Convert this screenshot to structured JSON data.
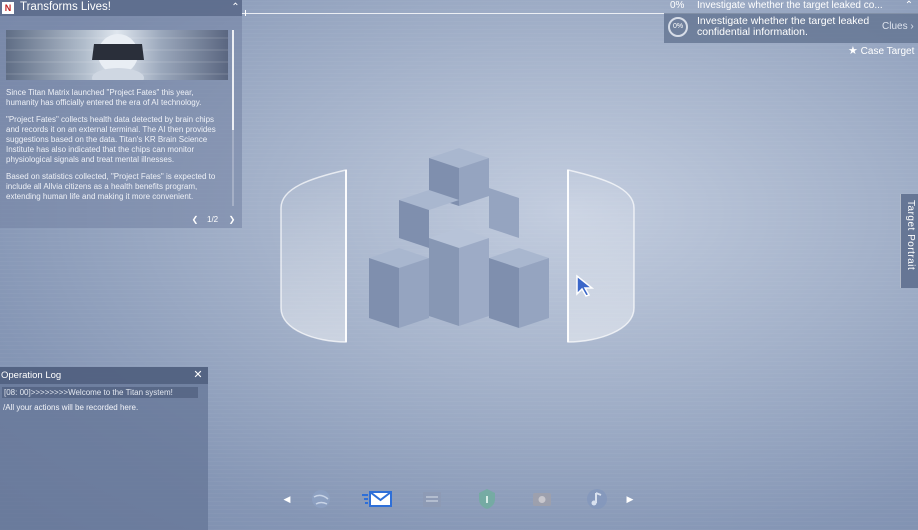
{
  "news": {
    "logo": "N",
    "title": "Transforms Lives!",
    "paragraphs": [
      "Since Titan Matrix launched \"Project Fates\" this year, humanity has officially entered the era of AI technology.",
      "\"Project Fates\" collects health data detected by brain chips and records it on an external terminal. The AI then provides suggestions based on the data. Titan's KR Brain Science Institute has also indicated that the chips can monitor physiological signals and treat mental illnesses.",
      "Based on statistics collected, \"Project Fates\" is expected to include all Allvia citizens as a health benefits program, extending human life and making it more convenient."
    ],
    "page": "1/2"
  },
  "mission": {
    "top_percent": "0%",
    "top_text": "Investigate whether the target leaked co...",
    "card_percent": "0%",
    "card_text": "Investigate whether the target leaked confidential information.",
    "clues_label": "Clues"
  },
  "case_target": "Case Target",
  "side_tab": "Target Portrait",
  "oplog": {
    "title": "Operation Log",
    "lines": [
      "[08: 00]>>>>>>>>Welcome to the Titan system!",
      "/All your actions will be recorded here."
    ]
  },
  "dock": {
    "icons": [
      "globe-icon",
      "mail-icon",
      "files-icon",
      "shield-icon",
      "camera-icon",
      "music-icon"
    ]
  },
  "colors": {
    "background": "#a4b2ca",
    "panel": "#72829f",
    "accent_mail": "#2e6fd8",
    "news_logo": "#c02020"
  }
}
